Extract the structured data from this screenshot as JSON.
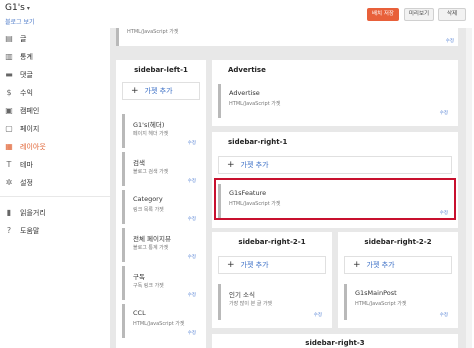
{
  "header": {
    "blog_title": "G1's",
    "blog_caret": "▾",
    "view_blog": "블로그 보기",
    "save_label": "배치 저장",
    "preview_label": "미리보기",
    "delete_label": "삭제"
  },
  "nav": [
    {
      "icon": "posts-icon",
      "glyph": "▤",
      "label": "글"
    },
    {
      "icon": "stats-icon",
      "glyph": "▥",
      "label": "통계"
    },
    {
      "icon": "comments-icon",
      "glyph": "▬",
      "label": "댓글"
    },
    {
      "icon": "earnings-icon",
      "glyph": "$",
      "label": "수익"
    },
    {
      "icon": "campaigns-icon",
      "glyph": "▣",
      "label": "캠페인"
    },
    {
      "icon": "pages-icon",
      "glyph": "▢",
      "label": "페이지"
    },
    {
      "icon": "layout-icon",
      "glyph": "▦",
      "label": "레이아웃",
      "active": true
    },
    {
      "icon": "theme-icon",
      "glyph": "T",
      "label": "테마"
    },
    {
      "icon": "settings-icon",
      "glyph": "✲",
      "label": "설정"
    }
  ],
  "nav_bottom": [
    {
      "icon": "reading-list-icon",
      "glyph": "▮",
      "label": "읽을거리"
    },
    {
      "icon": "help-icon",
      "glyph": "?",
      "label": "도움말"
    }
  ],
  "colors": {
    "accent": "#e06030",
    "highlight": "#c8102e",
    "link": "#3b6fc6"
  },
  "layout": {
    "top_gadget_sub": "HTML/JavaScript 가젯",
    "edit_label": "수정",
    "add_gadget_label": "가젯 추가",
    "sidebar_left": {
      "title": "sidebar-left-1",
      "gadgets": [
        {
          "title": "G1's(헤더)",
          "sub": "페이지 헤더 가젯"
        },
        {
          "title": "검색",
          "sub": "블로그 검색 가젯"
        },
        {
          "title": "Category",
          "sub": "링크 목록 가젯"
        },
        {
          "title": "전체 페이지뷰",
          "sub": "블로그 통계 가젯"
        },
        {
          "title": "구독",
          "sub": "구독 링크 가젯"
        },
        {
          "title": "CCL",
          "sub": "HTML/JavaScript 가젯"
        }
      ]
    },
    "advertise": {
      "title": "Advertise",
      "gadget": {
        "title": "Advertise",
        "sub": "HTML/JavaScript 가젯"
      }
    },
    "sidebar_right_1": {
      "title": "sidebar-right-1",
      "gadget": {
        "title": "G1sFeature",
        "sub": "HTML/JavaScript 가젯"
      }
    },
    "sidebar_right_2_1": {
      "title": "sidebar-right-2-1",
      "gadget": {
        "title": "인기 소식",
        "sub": "가장 많이 본 글 가젯"
      }
    },
    "sidebar_right_2_2": {
      "title": "sidebar-right-2-2",
      "gadget": {
        "title": "G1sMainPost",
        "sub": "HTML/JavaScript 가젯"
      }
    },
    "sidebar_right_3": {
      "title": "sidebar-right-3"
    }
  }
}
